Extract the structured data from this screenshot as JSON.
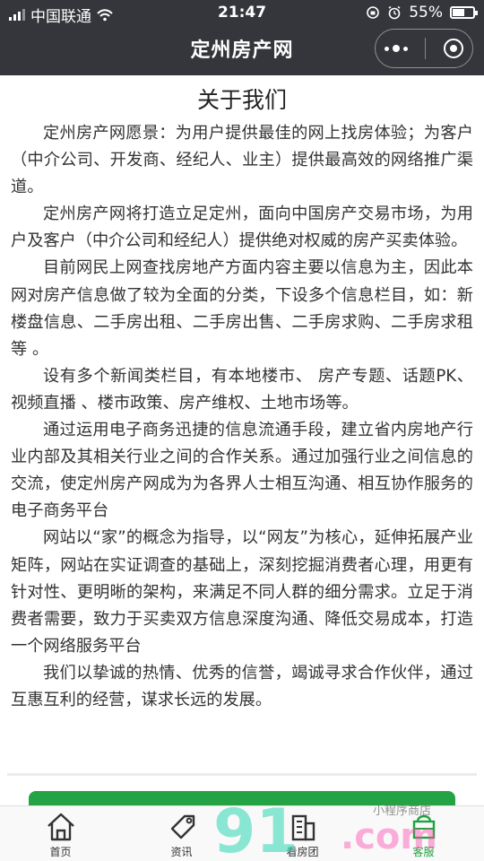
{
  "status_bar": {
    "carrier": "中国联通",
    "time": "21:47",
    "battery": "55%"
  },
  "nav": {
    "title": "定州房产网"
  },
  "page": {
    "title": "关于我们",
    "paragraphs": [
      "定州房产网愿景：为用户提供最佳的网上找房体验；为客户（中介公司、开发商、经纪人、业主）提供最高效的网络推广渠道。",
      "定州房产网将打造立足定州，面向中国房产交易市场，为用户及客户（中介公司和经纪人）提供绝对权威的房产买卖体验。",
      "目前网民上网查找房地产方面内容主要以信息为主，因此本网对房产信息做了较为全面的分类，下设多个信息栏目，如：新楼盘信息、二手房出租、二手房出售、二手房求购、二手房求租等 。",
      "设有多个新闻类栏目，有本地楼市、 房产专题、话题PK、视频直播 、楼市政策、房产维权、土地市场等。",
      "通过运用电子商务迅捷的信息流通手段，建立省内房地产行业内部及其相关行业之间的合作关系。通过加强行业之间信息的交流，使定州房产网成为为各界人士相互沟通、相互协作服务的电子商务平台",
      "网站以“家”的概念为指导，以“网友”为核心，延伸拓展产业矩阵，网站在实证调查的基础上，深刻挖掘消费者心理，用更有针对性、更明晰的架构，来满足不同人群的细分需求。立足于消费者需要，致力于买卖双方信息深度沟通、降低交易成本，打造一个网络服务平台",
      "我们以挚诚的热情、优秀的信誉，竭诚寻求合作伙伴，通过互惠互利的经营，谋求长远的发展。"
    ]
  },
  "tabbar": {
    "items": [
      {
        "label": "首页",
        "icon": "home-icon"
      },
      {
        "label": "资讯",
        "icon": "tag-icon"
      },
      {
        "label": "看房团",
        "icon": "building-icon"
      },
      {
        "label": "客服",
        "icon": "service-icon"
      }
    ]
  },
  "watermark": {
    "text_main": "91",
    "text_suffix": ".com",
    "text_small": "小程序商店"
  },
  "colors": {
    "header_bg": "#34363b",
    "accent_green": "#23a344"
  }
}
